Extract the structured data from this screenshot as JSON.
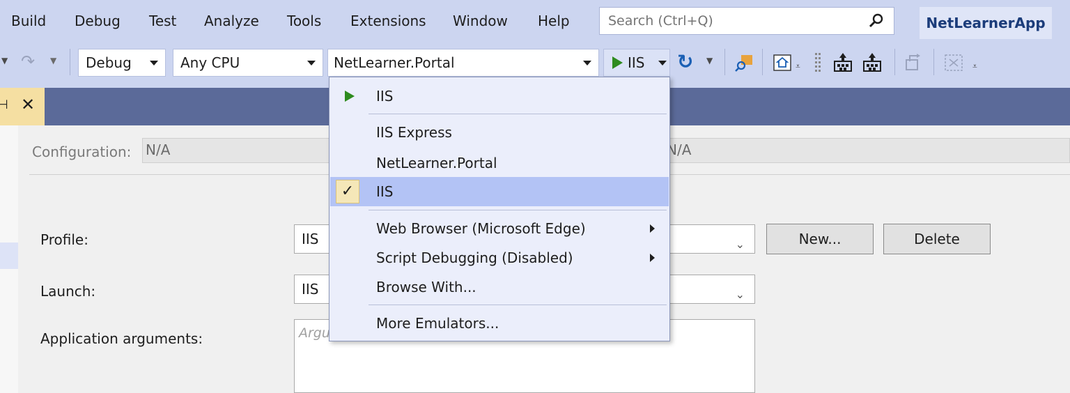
{
  "menu": {
    "items": [
      "Build",
      "Debug",
      "Test",
      "Analyze",
      "Tools",
      "Extensions",
      "Window",
      "Help"
    ]
  },
  "search": {
    "placeholder": "Search (Ctrl+Q)"
  },
  "app_name": "NetLearnerApp",
  "toolbar": {
    "configuration": "Debug",
    "platform": "Any CPU",
    "startup_project": "NetLearner.Portal",
    "run_target": "IIS"
  },
  "dropdown": {
    "items": [
      "IIS",
      "IIS Express",
      "NetLearner.Portal",
      "IIS",
      "Web Browser (Microsoft Edge)",
      "Script Debugging (Disabled)",
      "Browse With...",
      "More Emulators..."
    ],
    "checked_index": 3
  },
  "properties": {
    "configuration_label": "Configuration:",
    "configuration_value": "N/A",
    "platform_value": "N/A",
    "profile_label": "Profile:",
    "profile_value": "IIS",
    "launch_label": "Launch:",
    "launch_value": "IIS",
    "args_label": "Application arguments:",
    "args_placeholder": "Argu",
    "new_button": "New...",
    "delete_button": "Delete"
  },
  "colors": {
    "chrome": "#ccd5f0",
    "header_band": "#5b6a99",
    "run_green": "#2e8b1e",
    "selected": "#b3c3f5"
  }
}
